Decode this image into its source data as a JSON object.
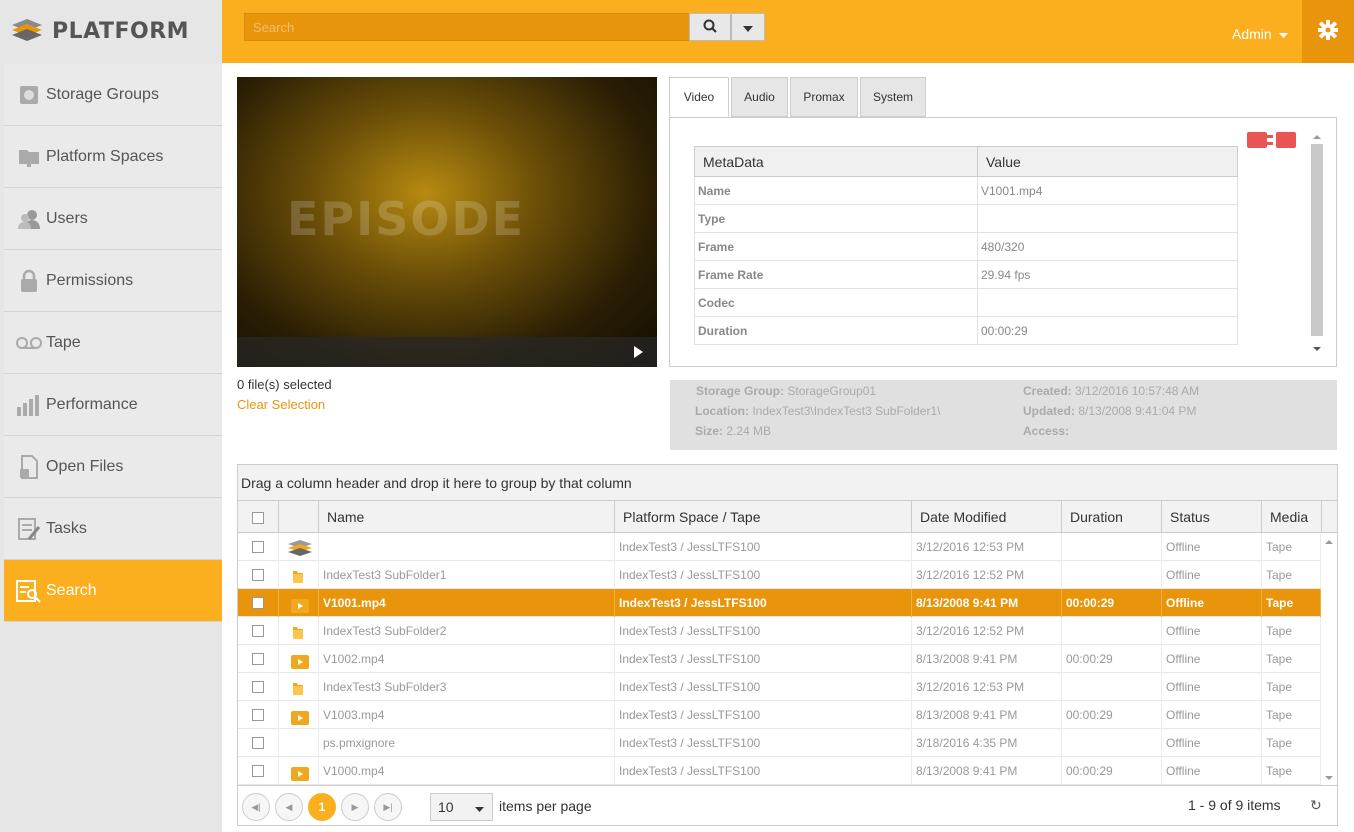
{
  "app": {
    "brand": "PLATFORM"
  },
  "search": {
    "placeholder": "Search",
    "admin_label": "Admin"
  },
  "sidebar": {
    "items": [
      {
        "label": "Storage Groups",
        "icon": "storage-icon"
      },
      {
        "label": "Platform Spaces",
        "icon": "spaces-icon"
      },
      {
        "label": "Users",
        "icon": "users-icon"
      },
      {
        "label": "Permissions",
        "icon": "lock-icon"
      },
      {
        "label": "Tape",
        "icon": "tape-icon"
      },
      {
        "label": "Performance",
        "icon": "chart-icon"
      },
      {
        "label": "Open Files",
        "icon": "open-file-icon"
      },
      {
        "label": "Tasks",
        "icon": "tasks-icon"
      },
      {
        "label": "Search",
        "icon": "search-list-icon",
        "active": true
      }
    ]
  },
  "preview": {
    "watermark": "EPISODE",
    "files_selected": "0 file(s) selected",
    "clear_selection": "Clear Selection"
  },
  "tabs": [
    "Video",
    "Audio",
    "Promax",
    "System"
  ],
  "metadata": {
    "col_key": "MetaData",
    "col_value": "Value",
    "rows": [
      {
        "k": "Name",
        "v": "V1001.mp4"
      },
      {
        "k": "Type",
        "v": ""
      },
      {
        "k": "Frame",
        "v": "480/320"
      },
      {
        "k": "Frame Rate",
        "v": "29.94 fps"
      },
      {
        "k": "Codec",
        "v": ""
      },
      {
        "k": "Duration",
        "v": "00:00:29"
      }
    ]
  },
  "info": {
    "storage_group_label": "Storage Group:",
    "storage_group": "StorageGroup01",
    "location_label": "Location:",
    "location": "IndexTest3\\IndexTest3 SubFolder1\\",
    "size_label": "Size:",
    "size": "2.24 MB",
    "created_label": "Created:",
    "created": "3/12/2016 10:57:48 AM",
    "updated_label": "Updated:",
    "updated": "8/13/2008 9:41:04 PM",
    "access_label": "Access:",
    "access": ""
  },
  "grid": {
    "group_hint": "Drag a column header and drop it here to group by that column",
    "columns": [
      "Name",
      "Platform Space / Tape",
      "Date Modified",
      "Duration",
      "Status",
      "Media"
    ],
    "rows": [
      {
        "icon": "platform-stack-icon",
        "name": "",
        "space": "IndexTest3 / JessLTFS100",
        "date": "3/12/2016 12:53 PM",
        "duration": "",
        "status": "Offline",
        "media": "Tape"
      },
      {
        "icon": "folder-icon",
        "name": "IndexTest3 SubFolder1",
        "space": "IndexTest3 / JessLTFS100",
        "date": "3/12/2016 12:52 PM",
        "duration": "",
        "status": "Offline",
        "media": "Tape"
      },
      {
        "icon": "video-file-icon",
        "name": "V1001.mp4",
        "space": "IndexTest3 / JessLTFS100",
        "date": "8/13/2008 9:41 PM",
        "duration": "00:00:29",
        "status": "Offline",
        "media": "Tape",
        "selected": true
      },
      {
        "icon": "folder-icon",
        "name": "IndexTest3 SubFolder2",
        "space": "IndexTest3 / JessLTFS100",
        "date": "3/12/2016 12:52 PM",
        "duration": "",
        "status": "Offline",
        "media": "Tape"
      },
      {
        "icon": "video-file-icon",
        "name": "V1002.mp4",
        "space": "IndexTest3 / JessLTFS100",
        "date": "8/13/2008 9:41 PM",
        "duration": "00:00:29",
        "status": "Offline",
        "media": "Tape"
      },
      {
        "icon": "folder-icon",
        "name": "IndexTest3 SubFolder3",
        "space": "IndexTest3 / JessLTFS100",
        "date": "3/12/2016 12:53 PM",
        "duration": "",
        "status": "Offline",
        "media": "Tape"
      },
      {
        "icon": "video-file-icon",
        "name": "V1003.mp4",
        "space": "IndexTest3 / JessLTFS100",
        "date": "8/13/2008 9:41 PM",
        "duration": "00:00:29",
        "status": "Offline",
        "media": "Tape"
      },
      {
        "icon": "",
        "name": "ps.pmxignore",
        "space": "IndexTest3 / JessLTFS100",
        "date": "3/18/2016 4:35 PM",
        "duration": "",
        "status": "Offline",
        "media": "Tape"
      },
      {
        "icon": "video-file-icon",
        "name": "V1000.mp4",
        "space": "IndexTest3 / JessLTFS100",
        "date": "8/13/2008 9:41 PM",
        "duration": "00:00:29",
        "status": "Offline",
        "media": "Tape"
      }
    ]
  },
  "pager": {
    "current_page": "1",
    "page_size": "10",
    "per_page_label": "items per page",
    "count": "1 - 9 of 9 items"
  },
  "colors": {
    "accent": "#fbaf1e",
    "accent_dark": "#e8950c"
  }
}
